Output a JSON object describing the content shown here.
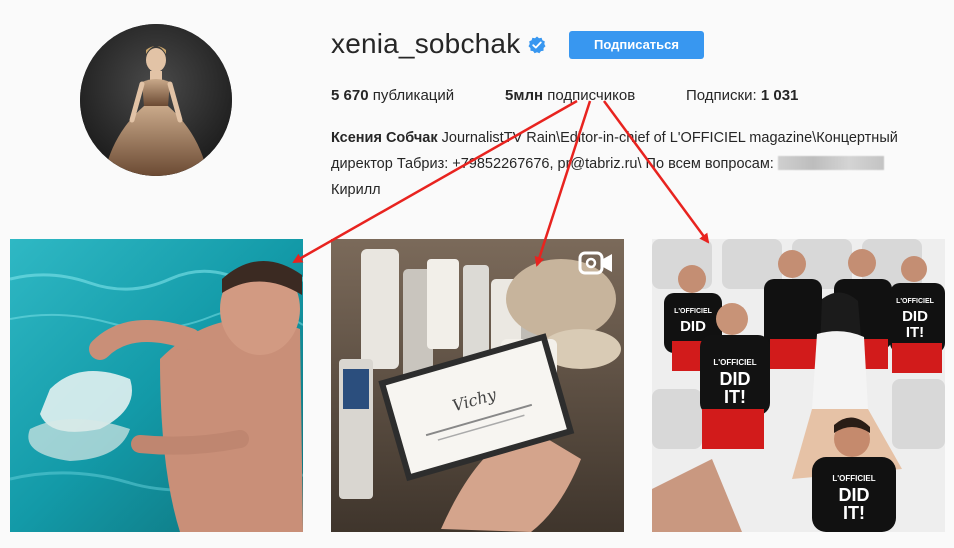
{
  "profile": {
    "username": "xenia_sobchak",
    "verified_icon": "verified-badge-icon",
    "follow_label": "Подписаться",
    "accent_color": "#3897f0"
  },
  "stats": {
    "posts_value": "5 670",
    "posts_label": "публикаций",
    "followers_value": "5млн",
    "followers_label": "подписчиков",
    "following_label": "Подписки:",
    "following_value": "1 031"
  },
  "bio": {
    "name": "Ксения Собчак",
    "text_1": " JournalistTV Rain\\Editor-in-chief of L'OFFICIEL magazine\\Концертный",
    "text_2": "директор Табриз: +79852267676, pr@tabriz.ru\\ По всем вопросам: ",
    "text_3": "Кирилл"
  },
  "posts": [
    {
      "type": "photo"
    },
    {
      "type": "video",
      "icon": "video-camera-icon",
      "product_text": "Vichy"
    },
    {
      "type": "photo",
      "shirt_brand": "L'OFFICIEL",
      "shirt_text_1": "DID",
      "shirt_text_2": "IT!"
    }
  ],
  "annotation_color": "#e8231f"
}
